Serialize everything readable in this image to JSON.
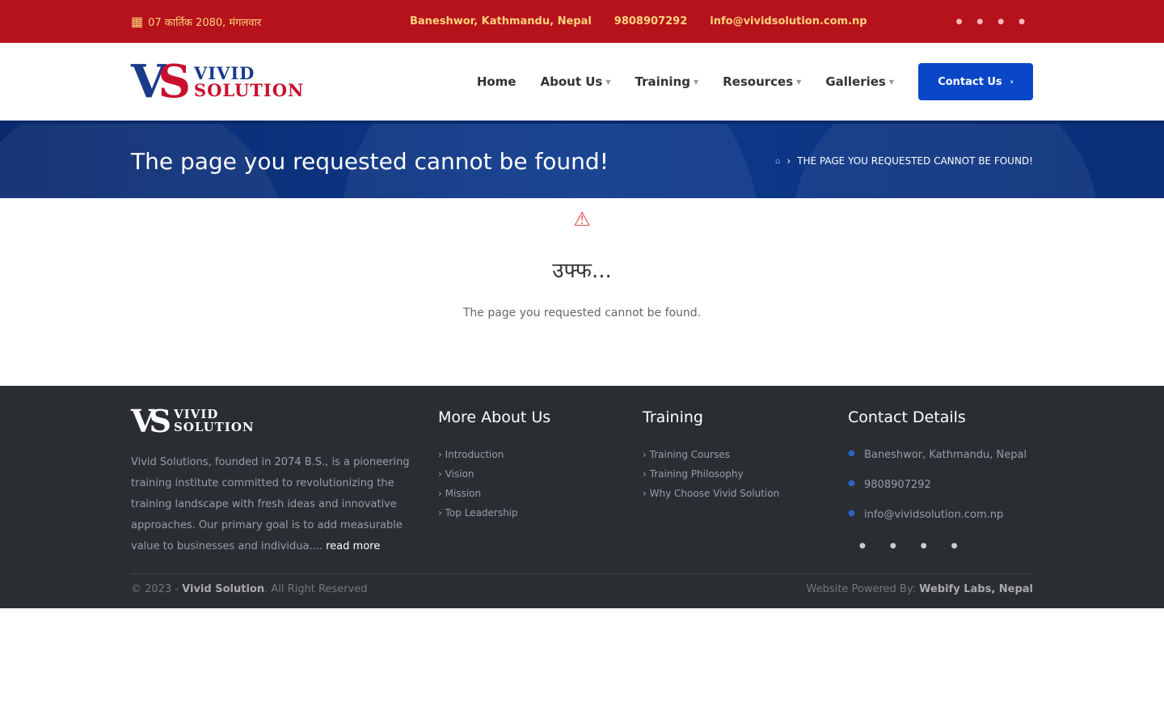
{
  "topbar": {
    "date": "07 कार्तिक 2080, मंगलवार",
    "address": "Baneshwor, Kathmandu, Nepal",
    "phone": "9808907292",
    "email": "info@vividsolution.com.np"
  },
  "header": {
    "logo_mark_v": "V",
    "logo_mark_s": "S",
    "logo_word1": "VIVID",
    "logo_word2": "SOLUTION",
    "nav": [
      {
        "label": "Home"
      },
      {
        "label": "About Us"
      },
      {
        "label": "Training"
      },
      {
        "label": "Resources"
      },
      {
        "label": "Galleries"
      }
    ],
    "contact_label": "Contact Us"
  },
  "banner": {
    "title": "The page you requested cannot be found!",
    "breadcrumb": "THE PAGE YOU REQUESTED CANNOT BE FOUND!"
  },
  "content": {
    "oops": "उफ्फ...",
    "message": "The page you requested cannot be found."
  },
  "footer": {
    "logo_mark": "VS",
    "logo_word1": "VIVID",
    "logo_word2": "SOLUTION",
    "description": "Vivid Solutions, founded in 2074 B.S., is a pioneering training institute committed to revolutionizing the training landscape with fresh ideas and innovative approaches. Our primary goal is to add measurable value to businesses and individua....",
    "read_more": "read more",
    "more_about_heading": "More About Us",
    "more_about": [
      "Introduction",
      "Vision",
      "Mission",
      "Top Leadership"
    ],
    "training_heading": "Training",
    "training": [
      "Training Courses",
      "Training Philosophy",
      "Why Choose Vivid Solution"
    ],
    "contact_heading": "Contact Details",
    "contact_address": "Baneshwor, Kathmandu, Nepal",
    "contact_phone": "9808907292",
    "contact_email": "info@vividsolution.com.np",
    "copyright_prefix": "© 2023 - ",
    "copyright_brand": "Vivid Solution",
    "copyright_suffix": ". All Right Reserved",
    "powered_prefix": "Website Powered By: ",
    "powered_brand": "Webify Labs, Nepal"
  },
  "colors": {
    "topbar": "#b5121b",
    "accent_yellow": "#ffd27a",
    "primary_blue": "#0a46c8",
    "banner_blue": "#0b2a6e",
    "footer_bg": "#2a2d32"
  },
  "icons": {
    "date": "calendar-icon",
    "social": [
      "facebook-icon",
      "twitter-icon",
      "instagram-icon",
      "youtube-icon"
    ],
    "warning": "warning-triangle-icon"
  }
}
